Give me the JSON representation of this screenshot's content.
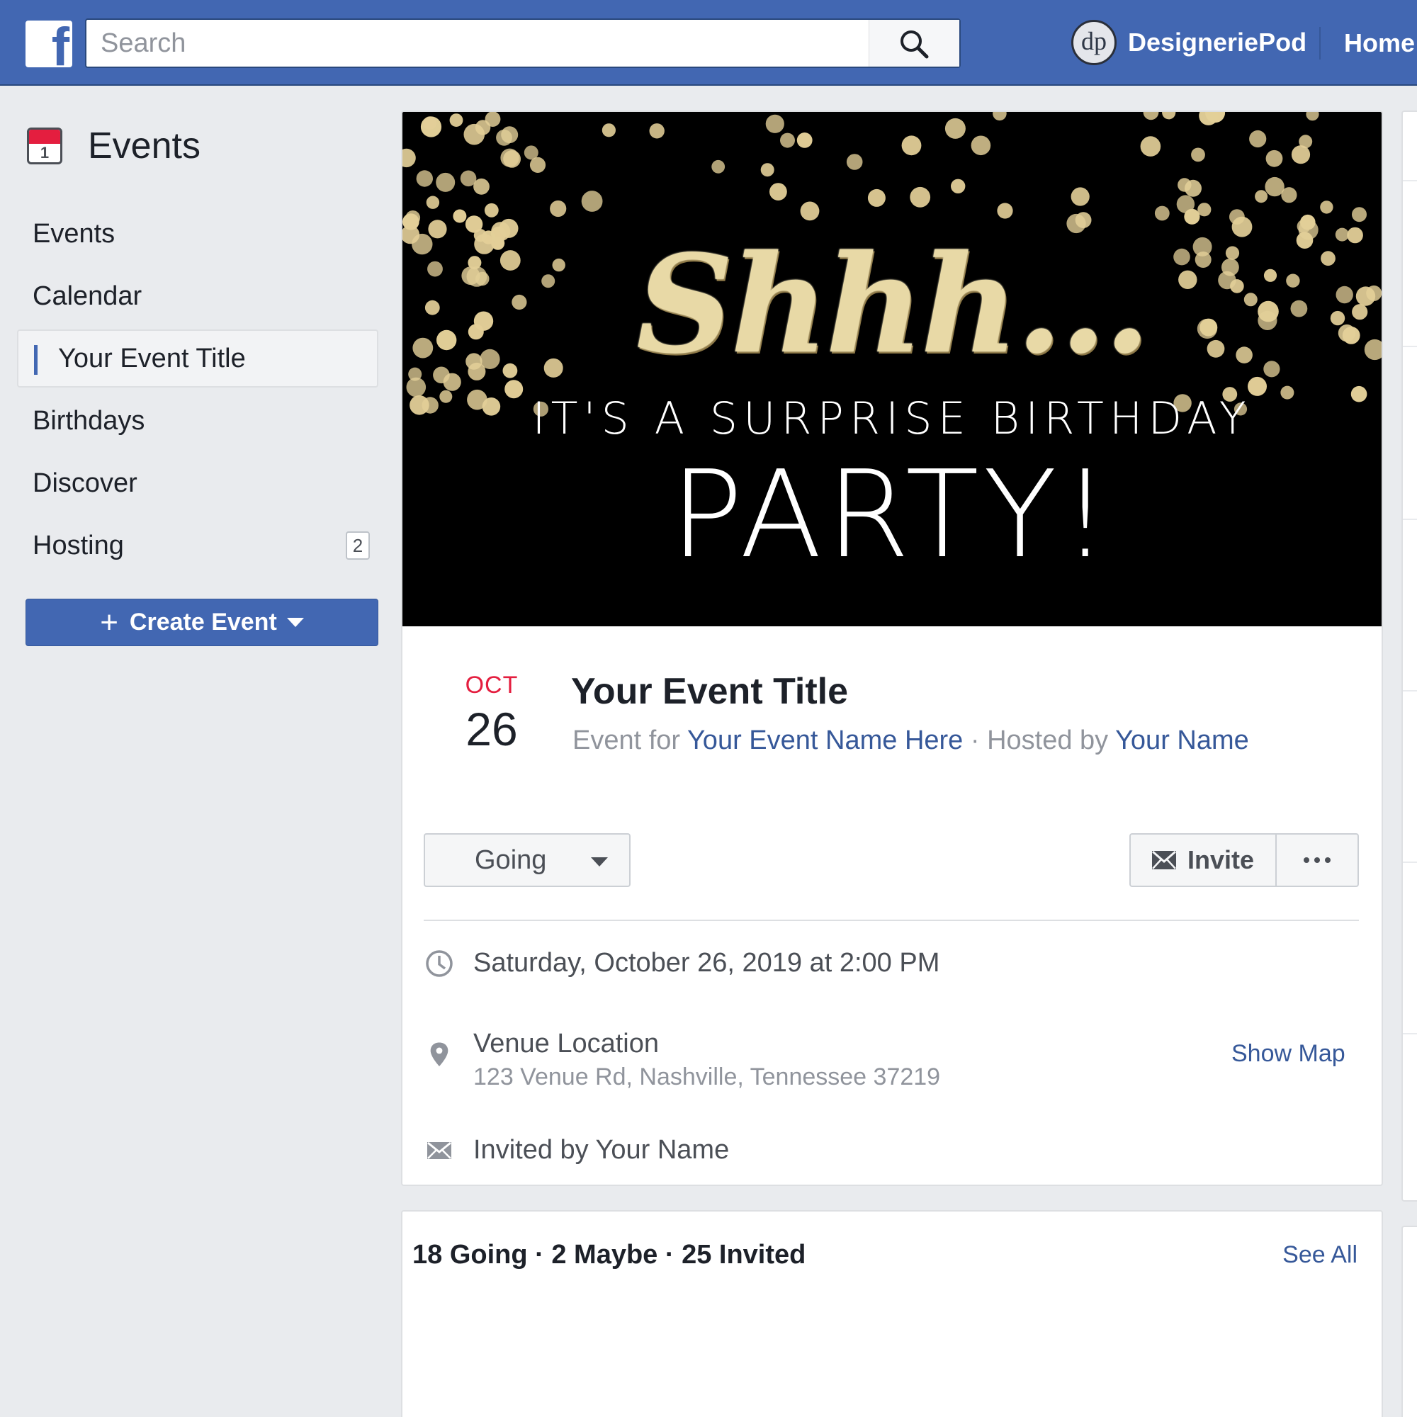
{
  "topbar": {
    "logo_letter": "f",
    "search_placeholder": "Search",
    "profile_initials": "dp",
    "profile_name": "DesigneriePod",
    "home_label": "Home"
  },
  "sidebar": {
    "title": "Events",
    "calendar_day": "1",
    "items": [
      {
        "label": "Events"
      },
      {
        "label": "Calendar"
      },
      {
        "label": "Your Event Title"
      },
      {
        "label": "Birthdays"
      },
      {
        "label": "Discover"
      },
      {
        "label": "Hosting",
        "badge": "2"
      }
    ],
    "create_label": "Create Event"
  },
  "cover": {
    "headline": "Shhh...",
    "subline": "IT'S A SURPRISE BIRTHDAY",
    "party": "PARTY!"
  },
  "event": {
    "month": "OCT",
    "day": "26",
    "title": "Your Event Title",
    "event_for_prefix": "Event for",
    "event_for_name": "Your Event Name Here",
    "separator": " · ",
    "hosted_by_prefix": "Hosted by",
    "host_name": "Your Name",
    "going_label": "Going",
    "invite_label": "Invite",
    "datetime": "Saturday, October 26, 2019 at 2:00 PM",
    "venue_name": "Venue Location",
    "venue_address": "123 Venue Rd, Nashville, Tennessee 37219",
    "show_map_label": "Show Map",
    "invited_by": "Invited by Your Name"
  },
  "stats": {
    "summary": "18 Going · 2 Maybe · 25 Invited",
    "see_all_label": "See All"
  },
  "colors": {
    "brand_blue": "#4267b2",
    "link_blue": "#365899",
    "date_red": "#e41e3f",
    "confetti_gold": "#e3cf98"
  }
}
